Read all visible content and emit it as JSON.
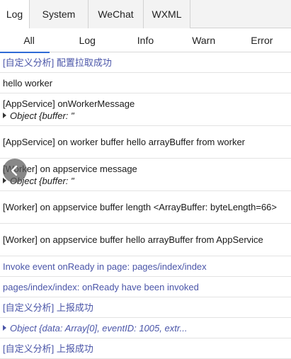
{
  "top_tabs": [
    "Log",
    "System",
    "WeChat",
    "WXML"
  ],
  "filter_tabs": [
    "All",
    "Log",
    "Info",
    "Warn",
    "Error"
  ],
  "logs": [
    {
      "text": "[自定义分析] 配置拉取成功"
    },
    {
      "text": "hello worker"
    },
    {
      "text": "[AppService] onWorkerMessage",
      "obj": "Object {buffer: \""
    },
    {
      "text": "[AppService] on worker buffer hello arrayBuffer from worker"
    },
    {
      "text": "[Worker] on appservice message",
      "obj": "Object {buffer: \""
    },
    {
      "text": "[Worker] on appservice buffer length <ArrayBuffer: byteLength=66>"
    },
    {
      "text": "[Worker] on appservice buffer hello arrayBuffer from AppService"
    },
    {
      "text": "Invoke event onReady in page: pages/index/index"
    },
    {
      "text": "pages/index/index: onReady have been invoked"
    },
    {
      "text": "[自定义分析] 上报成功"
    },
    {
      "obj": "Object {data: Array[0], eventID: 1005, extr..."
    },
    {
      "text": "[自定义分析] 上报成功"
    }
  ],
  "colors": {
    "accent": "#2f6bd6",
    "info_text": "#4a55a8"
  },
  "overlay_icon": "back-arrow-icon"
}
